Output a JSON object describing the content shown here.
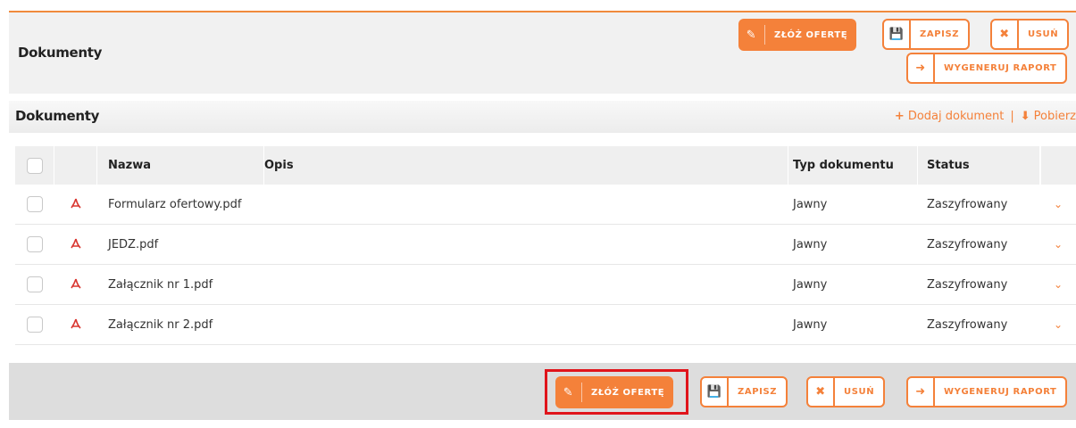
{
  "header": {
    "title": "Dokumenty",
    "buttons": {
      "zloz_oferte": "ZŁÓŻ OFERTĘ",
      "zapisz": "ZAPISZ",
      "usun": "USUŃ",
      "wygeneruj_raport": "WYGENERUJ RAPORT"
    }
  },
  "section": {
    "title": "Dokumenty",
    "add_link": "Dodaj dokument",
    "separator": "|",
    "download_link": "Pobierz"
  },
  "table": {
    "columns": {
      "name": "Nazwa",
      "opis": "Opis",
      "typ": "Typ dokumentu",
      "status": "Status"
    },
    "rows": [
      {
        "name": "Formularz ofertowy.pdf",
        "opis": "",
        "typ": "Jawny",
        "status": "Zaszyfrowany"
      },
      {
        "name": "JEDZ.pdf",
        "opis": "",
        "typ": "Jawny",
        "status": "Zaszyfrowany"
      },
      {
        "name": "Załącznik nr 1.pdf",
        "opis": "",
        "typ": "Jawny",
        "status": "Zaszyfrowany"
      },
      {
        "name": "Załącznik nr 2.pdf",
        "opis": "",
        "typ": "Jawny",
        "status": "Zaszyfrowany"
      }
    ]
  },
  "footer": {
    "buttons": {
      "zloz_oferte": "ZŁÓŻ OFERTĘ",
      "zapisz": "ZAPISZ",
      "usun": "USUŃ",
      "wygeneruj_raport": "WYGENERUJ RAPORT"
    }
  },
  "colors": {
    "accent": "#f4813a",
    "highlight": "#e0141b"
  },
  "icons": {
    "edit": "edit-icon",
    "save": "save-icon",
    "delete": "close-icon",
    "report": "sign-out-icon",
    "pdf": "pdf-file-icon",
    "expand": "chevron-down-icon",
    "add": "plus-icon",
    "download": "download-icon"
  }
}
